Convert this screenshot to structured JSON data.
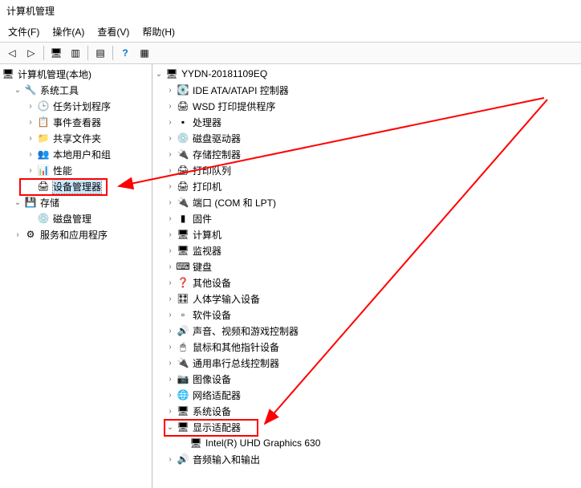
{
  "window": {
    "title": "计算机管理"
  },
  "menu": {
    "file": "文件(F)",
    "action": "操作(A)",
    "view": "查看(V)",
    "help": "帮助(H)"
  },
  "left_tree": {
    "root": "计算机管理(本地)",
    "system_tools": "系统工具",
    "task_scheduler": "任务计划程序",
    "event_viewer": "事件查看器",
    "shared_folders": "共享文件夹",
    "local_users": "本地用户和组",
    "performance": "性能",
    "device_manager": "设备管理器",
    "storage": "存储",
    "disk_management": "磁盘管理",
    "services": "服务和应用程序"
  },
  "right_tree": {
    "root": "YYDN-20181109EQ",
    "ide": "IDE ATA/ATAPI 控制器",
    "wsd": "WSD 打印提供程序",
    "cpu": "处理器",
    "disk_drive": "磁盘驱动器",
    "storage_ctrl": "存储控制器",
    "print_queue": "打印队列",
    "printer": "打印机",
    "ports": "端口 (COM 和 LPT)",
    "firmware": "固件",
    "computer": "计算机",
    "monitor": "监视器",
    "keyboard": "键盘",
    "other": "其他设备",
    "hid": "人体学输入设备",
    "software": "软件设备",
    "sound": "声音、视频和游戏控制器",
    "mouse": "鼠标和其他指针设备",
    "usb": "通用串行总线控制器",
    "imaging": "图像设备",
    "network": "网络适配器",
    "system": "系统设备",
    "display": "显示适配器",
    "gpu": "Intel(R) UHD Graphics 630",
    "audio_io": "音频输入和输出"
  },
  "annotation": {
    "color": "#ff0000"
  }
}
